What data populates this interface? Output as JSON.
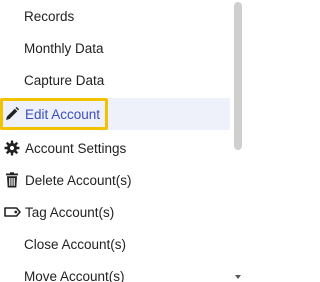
{
  "menu": {
    "items": [
      {
        "label": "Records",
        "icon": null
      },
      {
        "label": "Monthly Data",
        "icon": null
      },
      {
        "label": "Capture Data",
        "icon": null
      },
      {
        "label": "Edit Account",
        "icon": "pencil-icon",
        "active": true
      },
      {
        "label": "Account Settings",
        "icon": "gear-icon"
      },
      {
        "label": "Delete Account(s)",
        "icon": "trash-icon"
      },
      {
        "label": "Tag Account(s)",
        "icon": "tag-icon"
      },
      {
        "label": "Close Account(s)",
        "icon": null
      },
      {
        "label": "Move Account(s)",
        "icon": null
      }
    ]
  },
  "colors": {
    "active_text": "#3a4dc2",
    "active_bg": "#eef0fa",
    "highlight_border": "#f2c200"
  }
}
